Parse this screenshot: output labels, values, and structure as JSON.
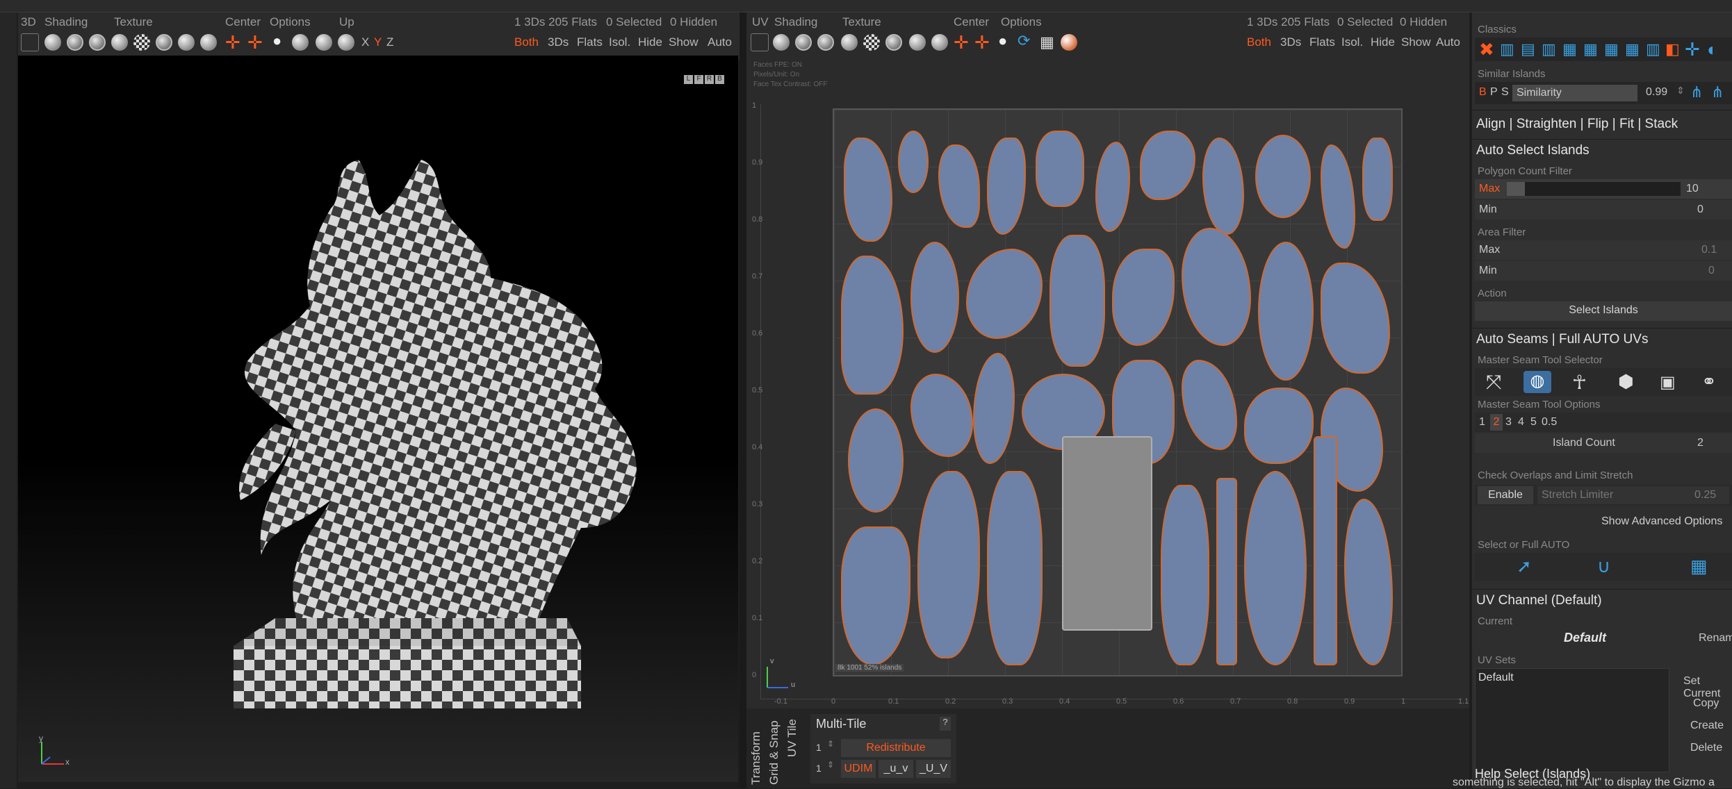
{
  "left_viewport": {
    "menu": [
      "3D",
      "Shading",
      "Texture",
      "Center",
      "Options",
      "Up"
    ],
    "status": [
      "1 3Ds 205 Flats",
      "0 Selected",
      "0 Hidden"
    ],
    "axes": [
      "X",
      "Y",
      "Z"
    ],
    "filters": [
      "Both",
      "3Ds",
      "Flats",
      "Isol.",
      "Hide",
      "Show",
      "Auto"
    ],
    "cube_letters": [
      "L",
      "F",
      "R",
      "B"
    ],
    "gizmo_y": "y",
    "gizmo_x": "x"
  },
  "uv_viewport": {
    "menu": [
      "UV",
      "Shading",
      "Texture",
      "Center",
      "Options"
    ],
    "status": [
      "1 3Ds 205 Flats",
      "0 Selected",
      "0 Hidden"
    ],
    "filters": [
      "Both",
      "3Ds",
      "Flats",
      "Isol.",
      "Hide",
      "Show",
      "Auto"
    ],
    "overlay": [
      "Faces FPE: ON",
      "Pixels/Unit: On",
      "Face Tex Contrast: OFF"
    ],
    "footer_label": "8k 1001 52% islands",
    "gizmo_v": "v",
    "gizmo_u": "u",
    "x_ticks": [
      "-0.1",
      "0",
      "0.1",
      "0.2",
      "0.3",
      "0.4",
      "0.5",
      "0.6",
      "0.7",
      "0.8",
      "0.9",
      "1",
      "1.1"
    ],
    "y_ticks": [
      "1",
      "0.9",
      "0.8",
      "0.7",
      "0.6",
      "0.5",
      "0.4",
      "0.3",
      "0.2",
      "0.1",
      "0"
    ]
  },
  "bottom_panel": {
    "vertical_tabs": [
      "Transform",
      "Grid & Snap",
      "UV Tile"
    ],
    "multi_tile_title": "Multi-Tile",
    "help": "?",
    "row1_value": "1",
    "redistribute": "Redistribute",
    "row2_value": "1",
    "udim": "UDIM",
    "u_v": "_u_v",
    "U_V": "_U_V"
  },
  "right_panel": {
    "classics_title": "Classics",
    "similar_title": "Similar Islands",
    "similar_flags": [
      "B",
      "P",
      "S"
    ],
    "similarity_label": "Similarity",
    "similarity_value": "0.99",
    "align_bar": "Align | Straighten | Flip | Fit | Stack",
    "auto_select_title": "Auto Select Islands",
    "poly_filter_title": "Polygon Count Filter",
    "poly_max_label": "Max",
    "poly_max_value": "10",
    "poly_min_label": "Min",
    "poly_min_value": "0",
    "area_filter_title": "Area Filter",
    "area_max_label": "Max",
    "area_max_value": "0.1",
    "area_min_label": "Min",
    "area_min_value": "0",
    "action_title": "Action",
    "select_islands": "Select Islands",
    "auto_seams_title": "Auto Seams | Full AUTO UVs",
    "master_seam_selector": "Master Seam Tool Selector",
    "master_seam_options": "Master Seam Tool Options",
    "seam_options": [
      "1",
      "2",
      "3",
      "4",
      "5",
      "0.5"
    ],
    "island_count_label": "Island Count",
    "island_count_value": "2",
    "overlap_title": "Check Overlaps and Limit Stretch",
    "enable": "Enable",
    "stretch_label": "Stretch Limiter",
    "stretch_value": "0.25",
    "advanced": "Show Advanced Options",
    "select_full_auto": "Select or Full AUTO",
    "uv_channel_title": "UV Channel (Default)",
    "current_label": "Current",
    "current_value": "Default",
    "rename": "Rename",
    "uv_sets_label": "UV Sets",
    "uv_set_item": "Default",
    "set_current": "Set Current",
    "copy": "Copy",
    "create": "Create",
    "delete": "Delete",
    "help_select": "Help Select (Islands)"
  },
  "caption": "something is selected, hit \"Alt\" to display the Gizmo a",
  "colors": {
    "accent": "#ff5a1f",
    "island_fill": "#6e82a8",
    "island_edge": "#d2692e"
  }
}
